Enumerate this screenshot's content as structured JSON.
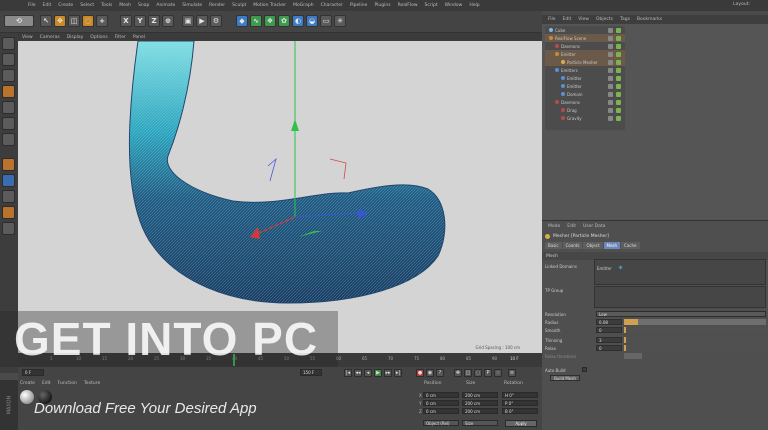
{
  "app": {
    "menu": [
      "File",
      "Edit",
      "Create",
      "Select",
      "Tools",
      "Mesh",
      "Snap",
      "Animate",
      "Simulate",
      "Render",
      "Sculpt",
      "Motion Tracker",
      "MoGraph",
      "Character",
      "Pipeline",
      "Plugins",
      "RealFlow",
      "Script",
      "Window",
      "Help"
    ],
    "layout_label": "Layout:",
    "toolbar": {
      "x": "X",
      "y": "Y",
      "z": "Z"
    }
  },
  "viewport": {
    "menu": [
      "View",
      "Cameras",
      "Display",
      "Options",
      "Filter",
      "Panel"
    ],
    "grid_spacing": "Grid Spacing : 100 cm"
  },
  "object_manager": {
    "menu": [
      "File",
      "Edit",
      "View",
      "Objects",
      "Tags",
      "Bookmarks"
    ],
    "objects": [
      {
        "name": "Cube",
        "dot": "#7fb6e6",
        "selected": false
      },
      {
        "name": "RealFlow Scene",
        "dot": "#c78a3a",
        "selected": true
      },
      {
        "name": "Daemons",
        "dot": "#b94a4a",
        "selected": false
      },
      {
        "name": "Emitter",
        "dot": "#c78a3a",
        "selected": true
      },
      {
        "name": "Particle Mesher",
        "dot": "#d6b04a",
        "selected": true
      },
      {
        "name": "Emitters",
        "dot": "#5c8ed6",
        "selected": false
      },
      {
        "name": "Emitter",
        "dot": "#5c8ed6",
        "selected": false
      },
      {
        "name": "Emitter",
        "dot": "#5c8ed6",
        "selected": false
      },
      {
        "name": "Domain",
        "dot": "#5c8ed6",
        "selected": false
      },
      {
        "name": "Daemons",
        "dot": "#b94a4a",
        "selected": false
      },
      {
        "name": "Drag",
        "dot": "#b94a4a",
        "selected": false
      },
      {
        "name": "Gravity",
        "dot": "#b94a4a",
        "selected": false
      }
    ]
  },
  "attribute_manager": {
    "menu": [
      "Mode",
      "Edit",
      "User Data"
    ],
    "title": "Mesher [Particle Mesher]",
    "tabs": [
      "Basic",
      "Coords",
      "Object",
      "Mesh",
      "Cache"
    ],
    "active_tab": "Mesh",
    "section": "Mesh",
    "linked_label": "Linked Domains",
    "linked_value": "Emitter",
    "tp_group": "TP Group",
    "rows": [
      {
        "label": "Resolution",
        "value": "Low"
      },
      {
        "label": "Radius",
        "value": "0.08"
      },
      {
        "label": "Smooth",
        "value": "0"
      },
      {
        "label": "Thinning",
        "value": "3"
      },
      {
        "label": "Relax",
        "value": "0"
      },
      {
        "label": "Relax Iterations",
        "value": ""
      },
      {
        "label": "Auto Build",
        "value": ""
      }
    ],
    "build_label": "Build Mesh"
  },
  "timeline": {
    "ticks": [
      "5",
      "10",
      "15",
      "20",
      "25",
      "30",
      "35",
      "40",
      "45",
      "50",
      "55",
      "60",
      "65",
      "70",
      "75",
      "80",
      "85",
      "90"
    ],
    "current_frame": "10 F",
    "start": "0 F",
    "end": "150 F",
    "play_buttons": [
      "|◂",
      "◂◂",
      "◂",
      "▶",
      "▸▸",
      "▸|"
    ]
  },
  "material_manager": {
    "menu": [
      "Create",
      "Edit",
      "Function",
      "Texture"
    ]
  },
  "coordinates": {
    "headers": [
      "Position",
      "Size",
      "Rotation"
    ],
    "rows": [
      {
        "axis": "X",
        "pos": "0 cm",
        "size": "200 cm",
        "rot": "H 0°"
      },
      {
        "axis": "Y",
        "pos": "0 cm",
        "size": "200 cm",
        "rot": "P 0°"
      },
      {
        "axis": "Z",
        "pos": "0 cm",
        "size": "200 cm",
        "rot": "B 0°"
      }
    ],
    "mode": "Object (Rel)",
    "size_mode": "Size",
    "apply": "Apply"
  },
  "branding": {
    "maxon": "MAXON",
    "watermark": "GET INTO PC",
    "tagline": "Download Free Your Desired App"
  }
}
